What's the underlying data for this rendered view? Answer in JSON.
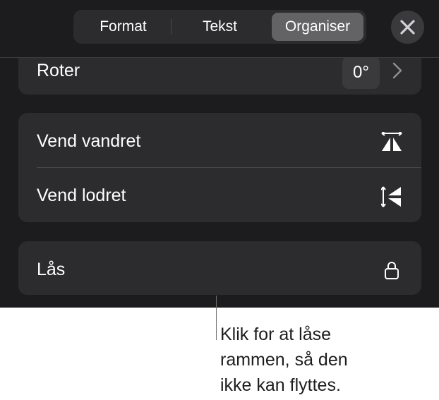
{
  "tabs": {
    "format": "Format",
    "tekst": "Tekst",
    "organiser": "Organiser",
    "selected": "Organiser"
  },
  "icons": {
    "close": "close-icon",
    "chevron": "chevron-right-icon",
    "flip_horizontal": "flip-horizontal-icon",
    "flip_vertical": "flip-vertical-icon",
    "lock": "lock-icon"
  },
  "rotate": {
    "label": "Roter",
    "value": "0°"
  },
  "flip": {
    "horizontal_label": "Vend vandret",
    "vertical_label": "Vend lodret"
  },
  "lock": {
    "label": "Lås"
  },
  "callout": {
    "text": "Klik for at låse\nrammen, så den\nikke kan flyttes."
  },
  "colors": {
    "panel_background": "#1c1c1e",
    "group_background": "#2c2c2e",
    "selected_tab": "#636366",
    "text": "#ffffff"
  }
}
